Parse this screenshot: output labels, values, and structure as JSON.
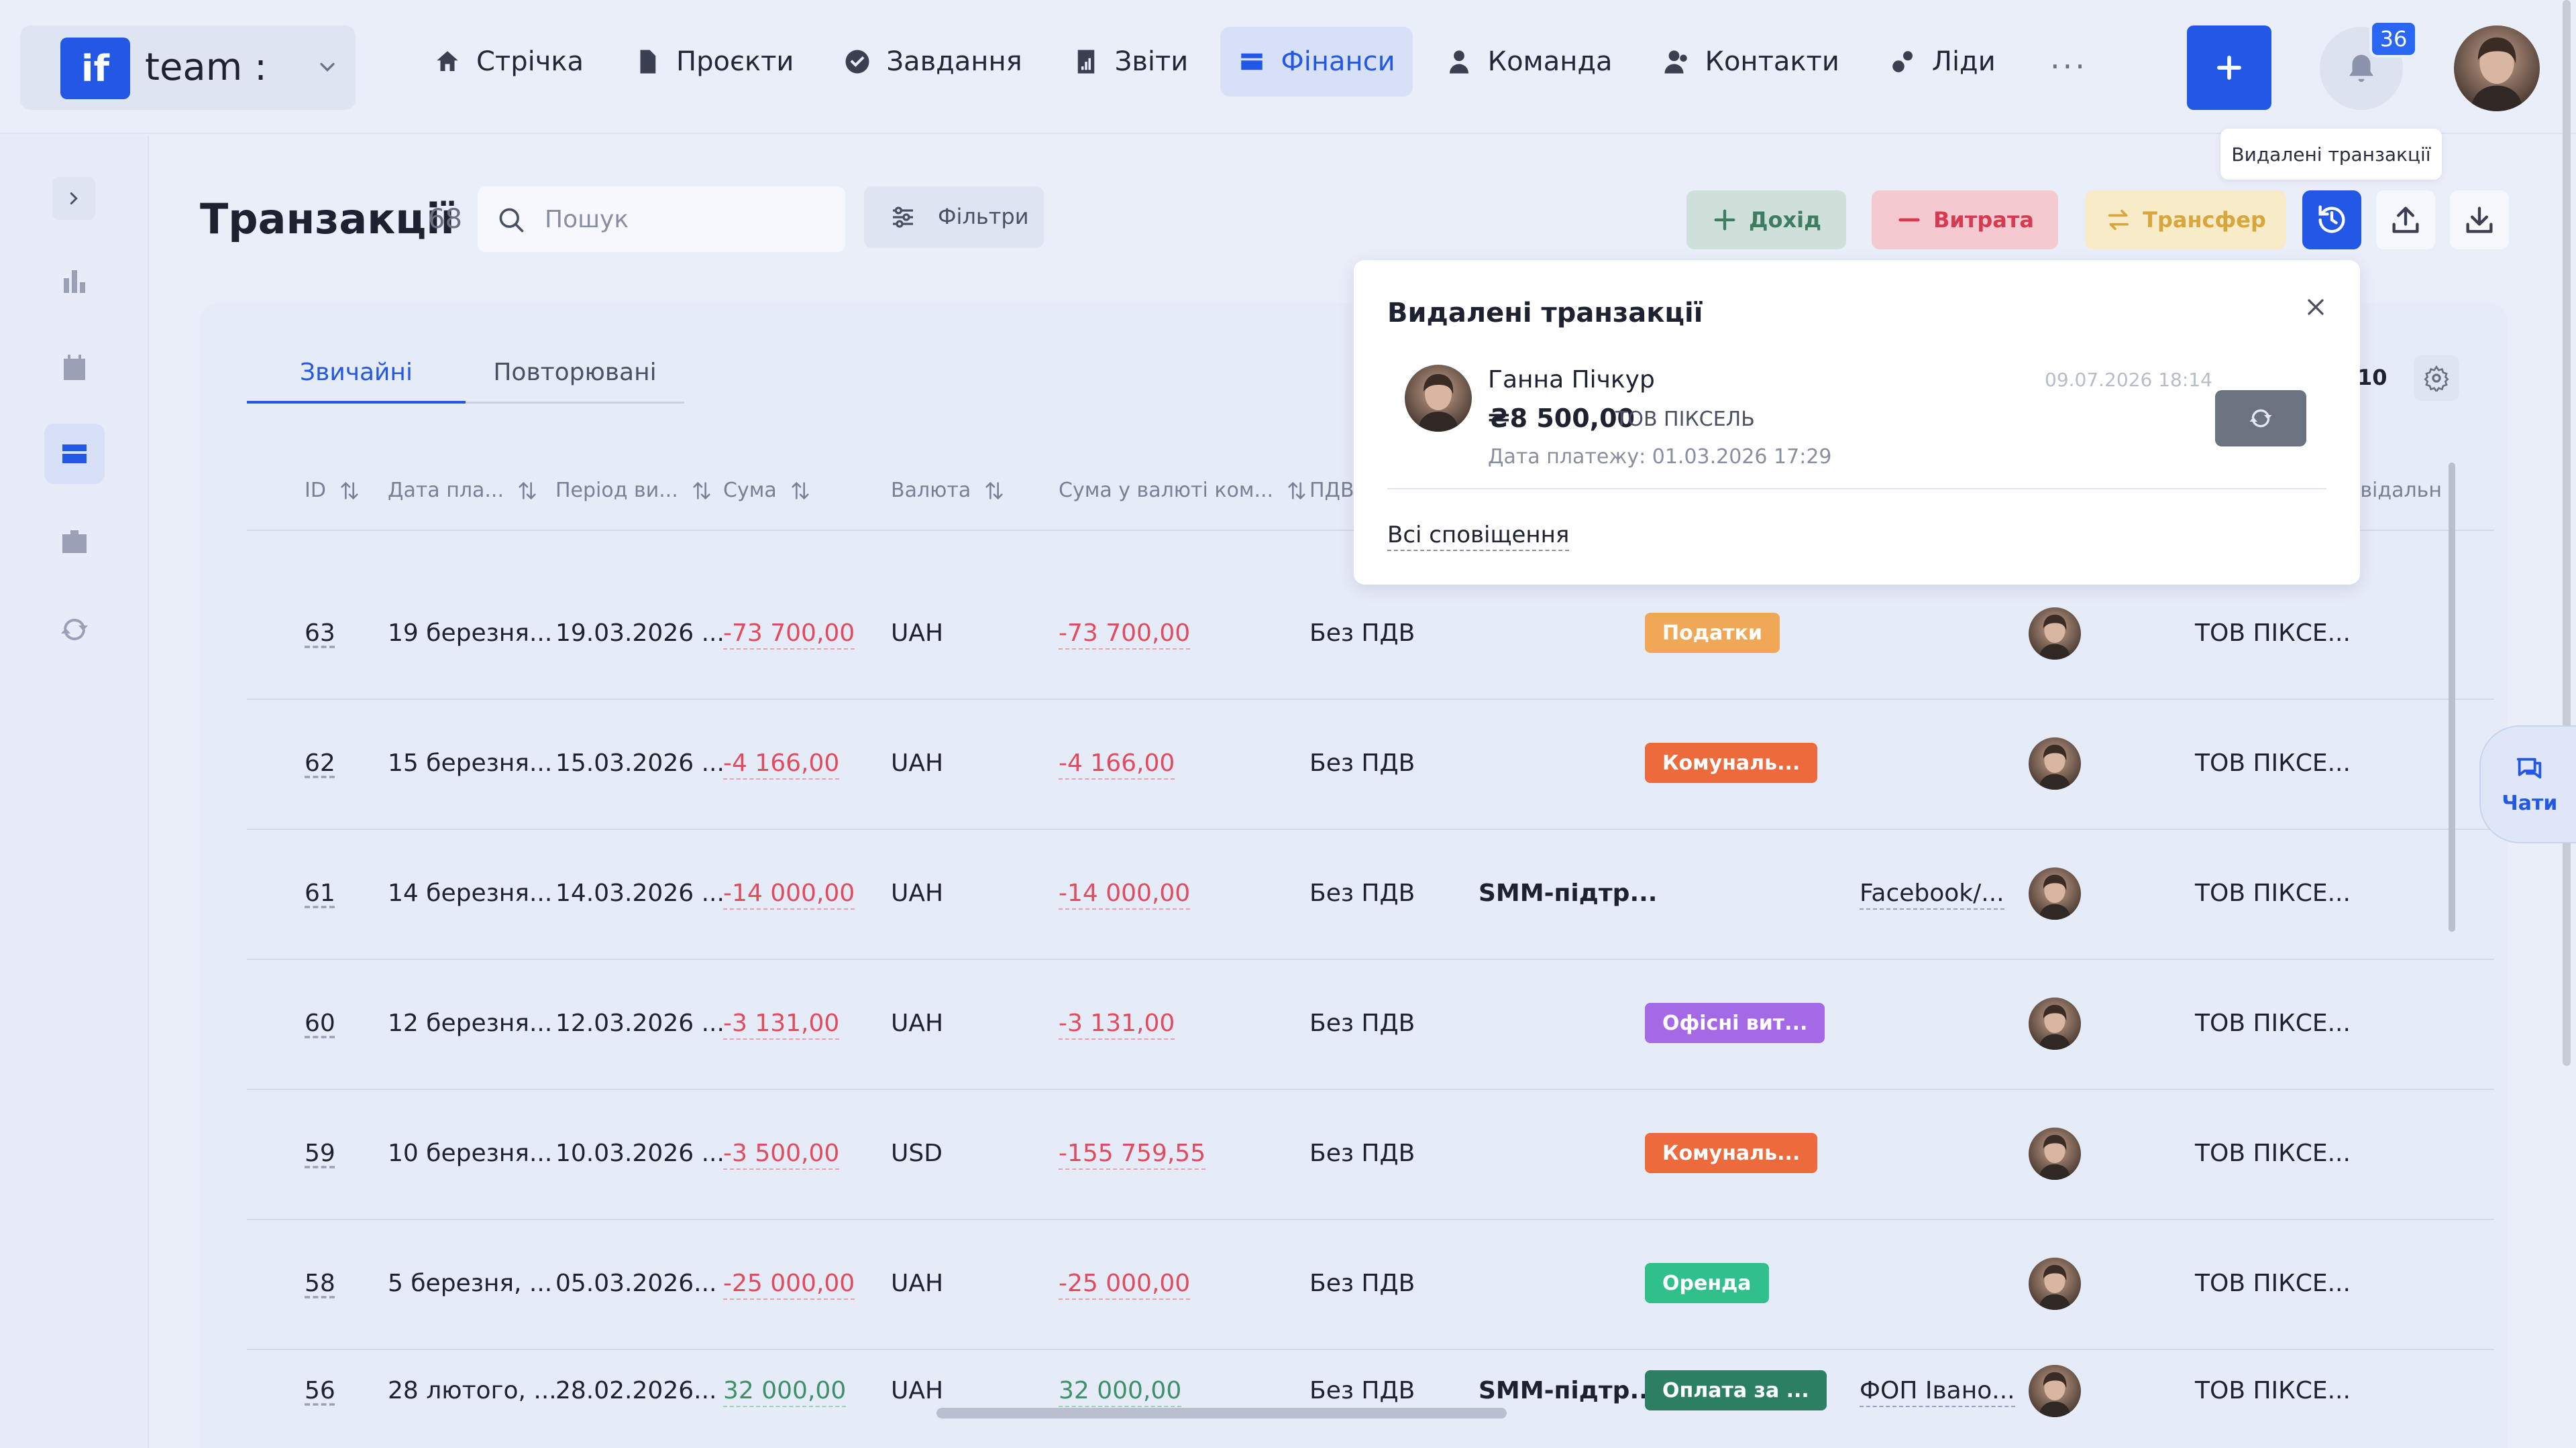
{
  "brand": {
    "logo": "if",
    "name": "team :"
  },
  "nav": [
    {
      "label": "Стрічка",
      "icon": "home-icon",
      "active": false
    },
    {
      "label": "Проєкти",
      "icon": "document-icon",
      "active": false
    },
    {
      "label": "Завдання",
      "icon": "check-circle-icon",
      "active": false
    },
    {
      "label": "Звіти",
      "icon": "report-icon",
      "active": false
    },
    {
      "label": "Фінанси",
      "icon": "wallet-icon",
      "active": true
    },
    {
      "label": "Команда",
      "icon": "person-icon",
      "active": false
    },
    {
      "label": "Контакти",
      "icon": "contacts-icon",
      "active": false
    },
    {
      "label": "Ліди",
      "icon": "leads-icon",
      "active": false
    }
  ],
  "nav_more": "···",
  "notifications": {
    "count": "36"
  },
  "page": {
    "title": "Транзакції",
    "count": "68"
  },
  "search": {
    "placeholder": "Пошук"
  },
  "filters_label": "Фільтри",
  "actions": {
    "income": "Дохід",
    "expense": "Витрата",
    "transfer": "Трансфер"
  },
  "tooltip": "Видалені транзакції",
  "tabs": [
    {
      "label": "Звичайні",
      "active": true
    },
    {
      "label": "Повторювані",
      "active": false
    }
  ],
  "columns": [
    "ID",
    "Дата пла...",
    "Період ви...",
    "Сума",
    "Валюта",
    "Сума у валюті ком...",
    "ПДВ"
  ],
  "partial_column": "овідальн",
  "partial_toolbar": "10",
  "rows": [
    {
      "id": "63",
      "date": "19 березня...",
      "period": "19.03.2026 ...",
      "sum": "-73 700,00",
      "currency": "UAH",
      "sum_company": "-73 700,00",
      "vat": "Без ПДВ",
      "project": "",
      "tag": "Податки",
      "tag_color": "#f0a857",
      "counterparty": "",
      "company": "ТОВ ПІКСЕ...",
      "sign": "neg"
    },
    {
      "id": "62",
      "date": "15 березня...",
      "period": "15.03.2026 ...",
      "sum": "-4 166,00",
      "currency": "UAH",
      "sum_company": "-4 166,00",
      "vat": "Без ПДВ",
      "project": "",
      "tag": "Комуналь...",
      "tag_color": "#ec6a3c",
      "counterparty": "",
      "company": "ТОВ ПІКСЕ...",
      "sign": "neg"
    },
    {
      "id": "61",
      "date": "14 березня...",
      "period": "14.03.2026 ...",
      "sum": "-14 000,00",
      "currency": "UAH",
      "sum_company": "-14 000,00",
      "vat": "Без ПДВ",
      "project": "SMM-підтр...",
      "tag": "",
      "tag_color": "",
      "counterparty": "Facebook/...",
      "company": "ТОВ ПІКСЕ...",
      "sign": "neg"
    },
    {
      "id": "60",
      "date": "12 березня...",
      "period": "12.03.2026 ...",
      "sum": "-3 131,00",
      "currency": "UAH",
      "sum_company": "-3 131,00",
      "vat": "Без ПДВ",
      "project": "",
      "tag": "Офісні вит...",
      "tag_color": "#a46ae6",
      "counterparty": "",
      "company": "ТОВ ПІКСЕ...",
      "sign": "neg"
    },
    {
      "id": "59",
      "date": "10 березня...",
      "period": "10.03.2026 ...",
      "sum": "-3 500,00",
      "currency": "USD",
      "sum_company": "-155 759,55",
      "vat": "Без ПДВ",
      "project": "",
      "tag": "Комуналь...",
      "tag_color": "#ec6a3c",
      "counterparty": "",
      "company": "ТОВ ПІКСЕ...",
      "sign": "neg"
    },
    {
      "id": "58",
      "date": "5 березня, ...",
      "period": "05.03.2026...",
      "sum": "-25 000,00",
      "currency": "UAH",
      "sum_company": "-25 000,00",
      "vat": "Без ПДВ",
      "project": "",
      "tag": "Оренда",
      "tag_color": "#2fc08c",
      "counterparty": "",
      "company": "ТОВ ПІКСЕ...",
      "sign": "neg"
    },
    {
      "id": "56",
      "date": "28 лютого, ...",
      "period": "28.02.2026...",
      "sum": "32 000,00",
      "currency": "UAH",
      "sum_company": "32 000,00",
      "vat": "Без ПДВ",
      "project": "SMM-підтр...",
      "tag": "Оплата за ...",
      "tag_color": "#2d7f63",
      "counterparty": "ФОП Івано...",
      "company": "ТОВ ПІКСЕ...",
      "sign": "pos"
    }
  ],
  "popover": {
    "title": "Видалені транзакції",
    "item": {
      "name": "Ганна Пічкур",
      "amount": "₴8 500,00",
      "company": "ТОВ ПІКСЕЛЬ",
      "pay_date": "Дата платежу: 01.03.2026 17:29",
      "deleted_at": "09.07.2026 18:14"
    },
    "all_link": "Всі сповіщення"
  },
  "chats_label": "Чати",
  "colors": {
    "accent": "#2357e6",
    "negative": "#e24a5d",
    "positive": "#3f8f6a"
  }
}
